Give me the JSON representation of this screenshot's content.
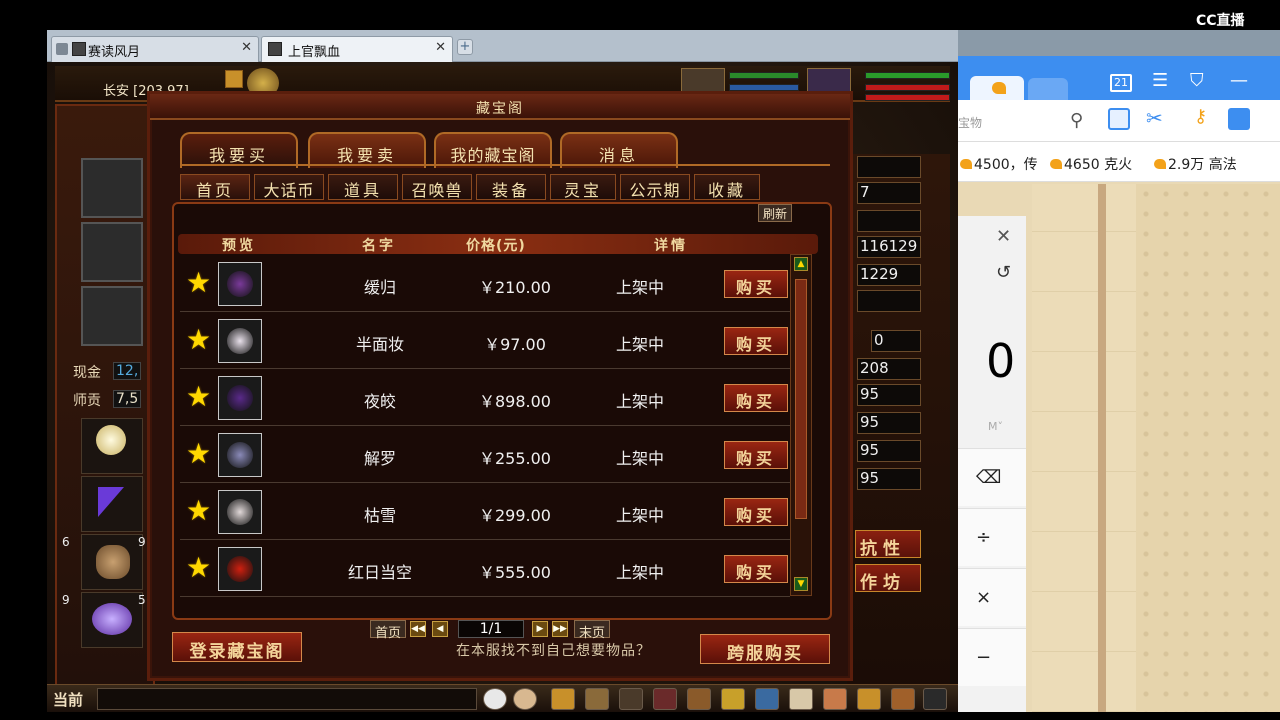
{
  "watermark": "CC直播",
  "browser_tabs": [
    {
      "title": "赛读风月"
    },
    {
      "title": "上官飘血"
    }
  ],
  "game": {
    "location": "长安 [203,97]",
    "left_panel": {
      "cash_label": "现金",
      "cash_value": "12,",
      "mentor_label": "师贡",
      "mentor_value": "7,5",
      "slot_counts": [
        "6",
        "9",
        "9",
        "5"
      ]
    },
    "right_stats": [
      "7",
      "116129",
      "1229",
      "0",
      "208",
      "95",
      "95",
      "95",
      "95"
    ],
    "right_labels": [
      "抗性",
      "作坊"
    ],
    "window": {
      "title": "藏宝阁",
      "main_tabs": [
        "我要买",
        "我要卖",
        "我的藏宝阁",
        "消息"
      ],
      "sub_tabs": [
        "首页",
        "大话币",
        "道具",
        "召唤兽",
        "装备",
        "灵宝",
        "公示期",
        "收藏"
      ],
      "refresh": "刷新",
      "columns": [
        "预览",
        "名字",
        "价格(元)",
        "详情"
      ],
      "items": [
        {
          "name": "缓归",
          "price": "￥210.00",
          "status": "上架中",
          "buy": "购买",
          "color": "#7a3a9a"
        },
        {
          "name": "半面妆",
          "price": "￥97.00",
          "status": "上架中",
          "buy": "购买",
          "color": "#e8e0ea"
        },
        {
          "name": "夜皎",
          "price": "￥898.00",
          "status": "上架中",
          "buy": "购买",
          "color": "#5a2a8a"
        },
        {
          "name": "解罗",
          "price": "￥255.00",
          "status": "上架中",
          "buy": "购买",
          "color": "#8a8ab8"
        },
        {
          "name": "枯雪",
          "price": "￥299.00",
          "status": "上架中",
          "buy": "购买",
          "color": "#e0d8d8"
        },
        {
          "name": "红日当空",
          "price": "￥555.00",
          "status": "上架中",
          "buy": "购买",
          "color": "#d02010"
        }
      ],
      "pager": {
        "first": "首页",
        "last": "末页",
        "page": "1/1"
      },
      "login_button": "登录藏宝阁",
      "hint": "在本服找不到自己想要物品？",
      "cross_button": "跨服购买"
    },
    "bottom_label": "当前"
  },
  "right_browser": {
    "tab_count": "21",
    "url_placeholder": "宝物",
    "bookmarks": [
      "4500，传",
      "4650 克火",
      "2.9万 高法"
    ],
    "calculator": {
      "value": "0",
      "mem": "M˅",
      "buttons": [
        "⌫",
        "÷",
        "×",
        "−"
      ]
    }
  }
}
